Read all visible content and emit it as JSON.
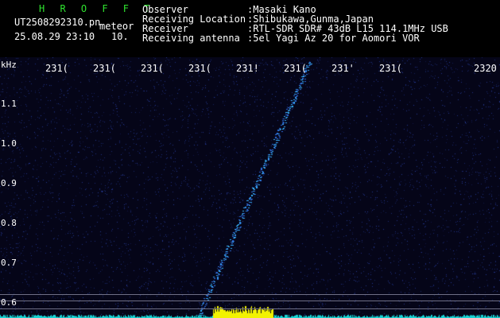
{
  "header": {
    "title": "H R O F F T",
    "filename": "UT2508292310.pn",
    "tag": "meteor",
    "datetime": "25.08.29 23:10",
    "interval": "10.",
    "labels": [
      "Observer",
      "Receiving Location",
      "Receiver",
      "Receiving antenna"
    ],
    "values": [
      ":Masaki Kano",
      ":Shibukawa,Gunma,Japan",
      ":RTL-SDR SDR# 43dB L15 114.1MHz USB",
      ":5el Yagi Az 20 for Aomori VOR"
    ]
  },
  "plot": {
    "unit": "kHz",
    "x_ticks": [
      "231(",
      "231(",
      "231(",
      "231(",
      "231!",
      "231(",
      "231'",
      "231(",
      "2320"
    ],
    "y_ticks": [
      "1.1",
      "1.0",
      "0.9",
      "0.8",
      "0.7",
      "0.6"
    ],
    "colors": {
      "background": "#050518",
      "noise": "#233a9a",
      "trace": "#39b3ff",
      "signal": "#f2f200",
      "baseline": "#19d4d4"
    }
  }
}
